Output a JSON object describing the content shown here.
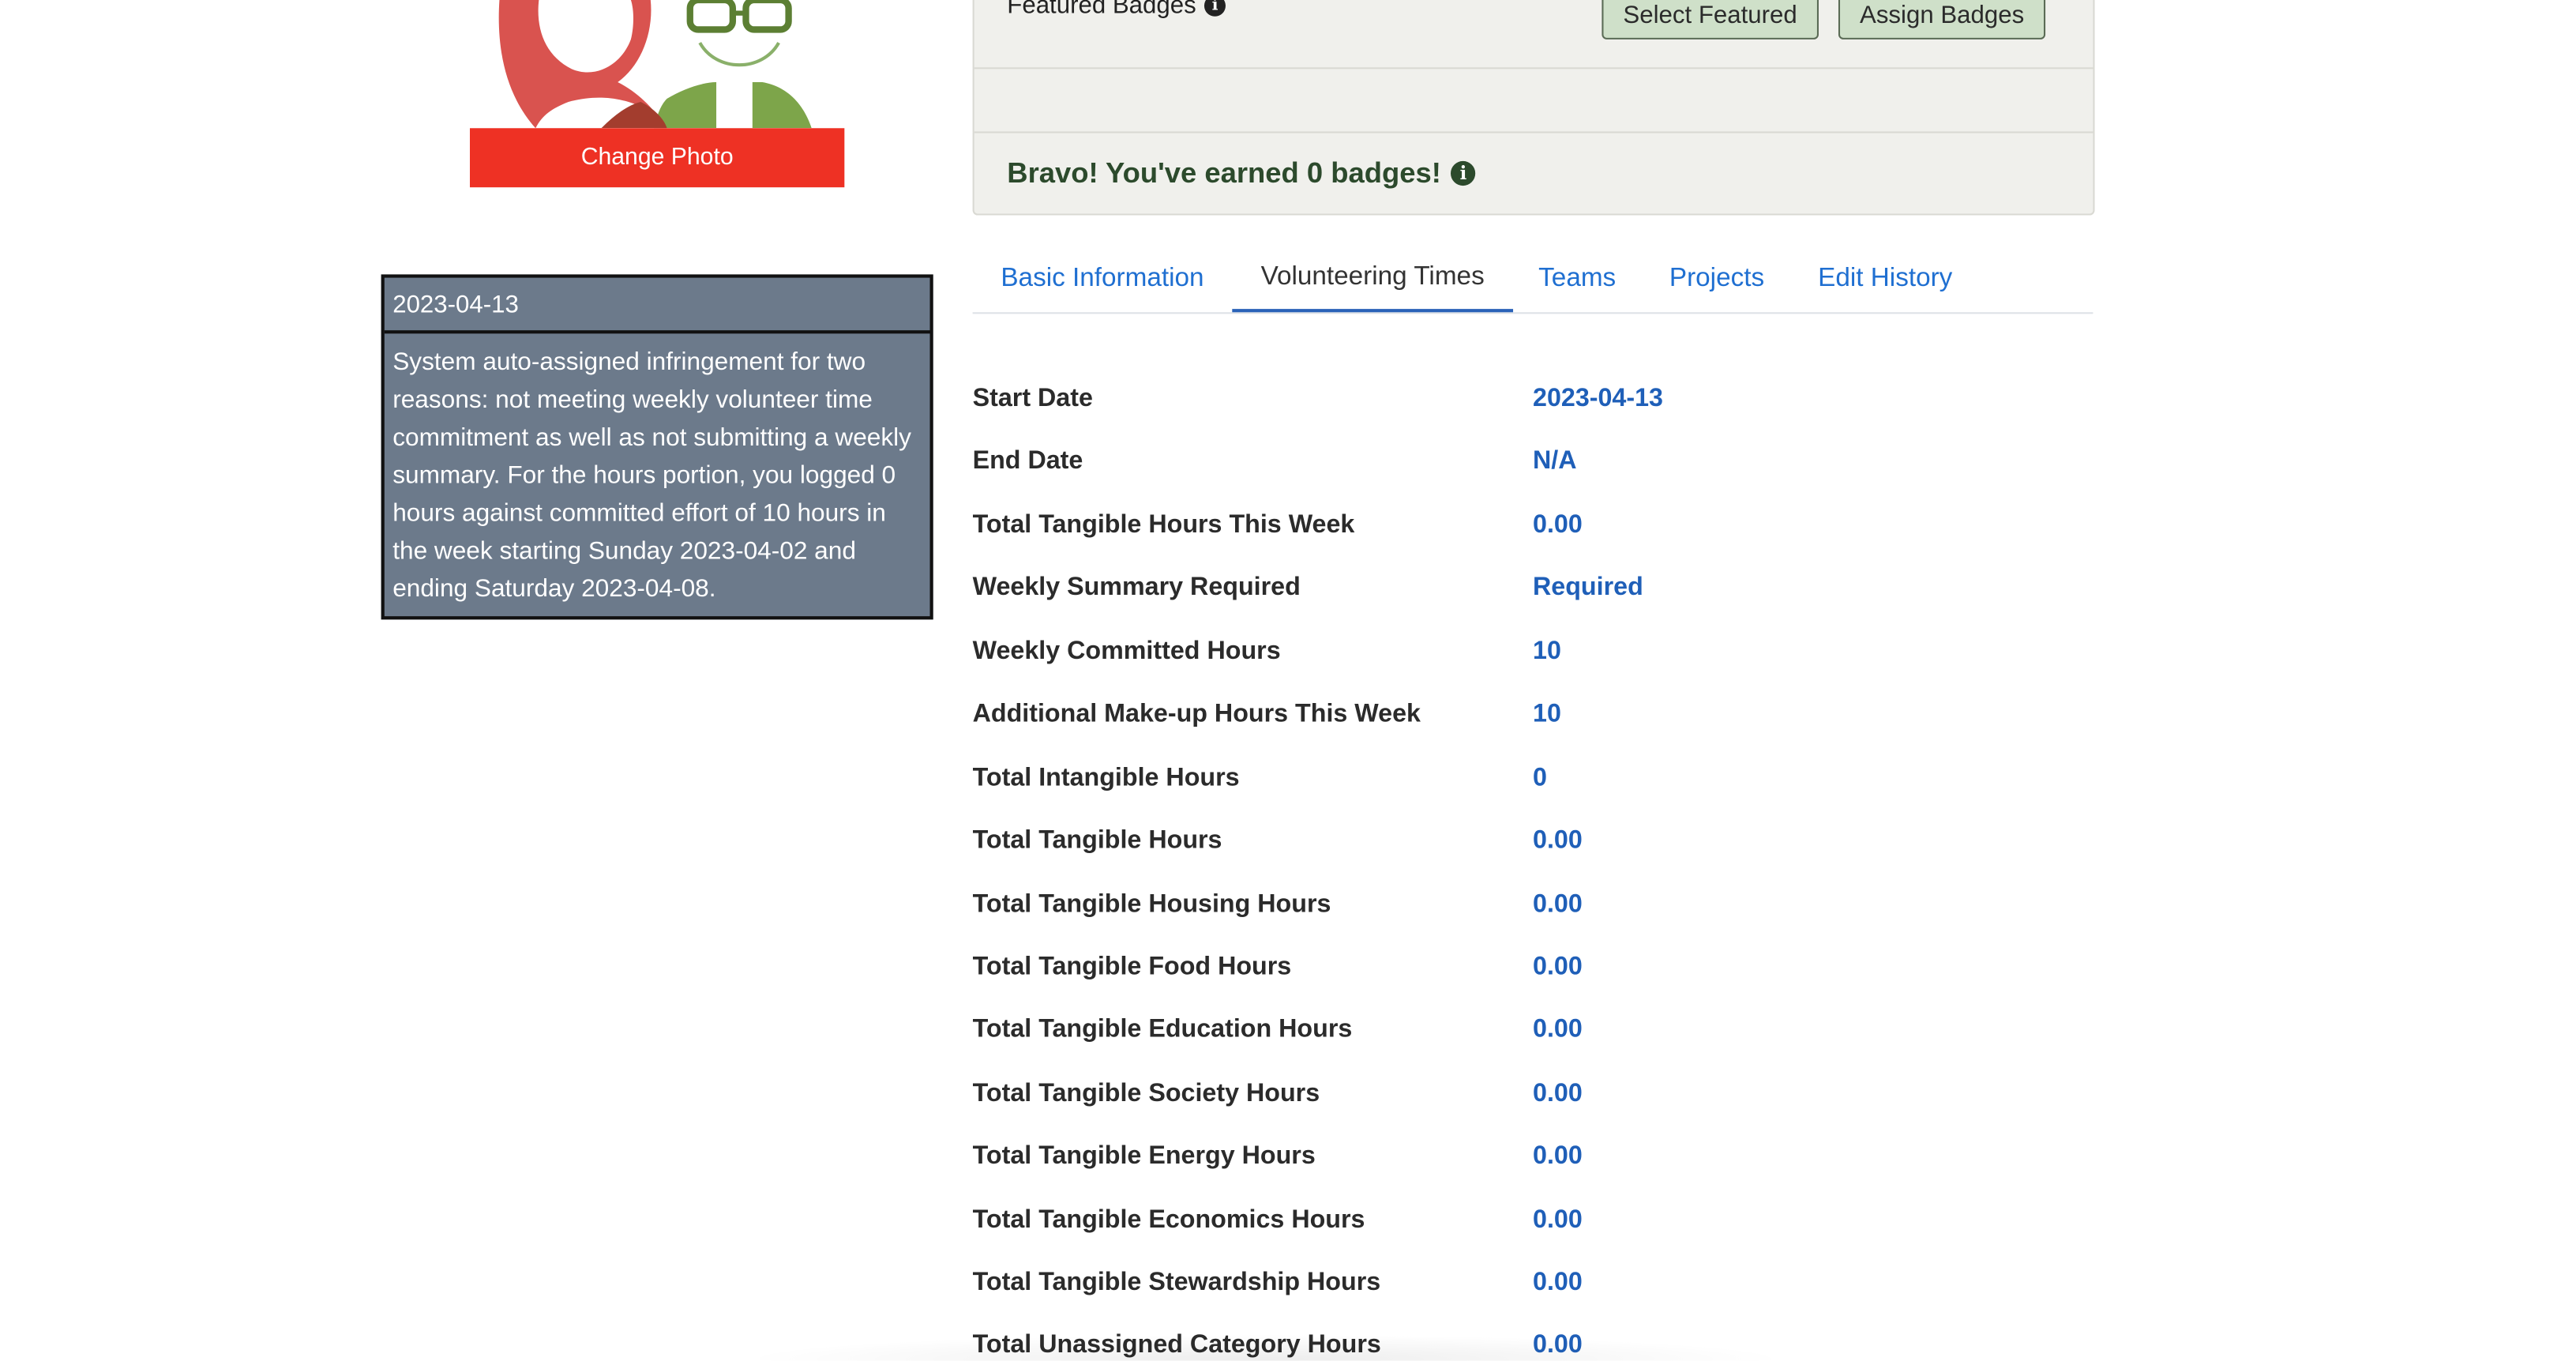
{
  "profile": {
    "change_photo_label": "Change Photo"
  },
  "infringement": {
    "date": "2023-04-13",
    "text": "System auto-assigned infringement for two reasons: not meeting weekly volunteer time commitment as well as not submitting a weekly summary. For the hours portion, you logged 0 hours against committed effort of 10 hours in the week starting Sunday 2023-04-02 and ending Saturday 2023-04-08."
  },
  "badges": {
    "header_title": "Featured Badges",
    "select_featured_label": "Select Featured",
    "assign_badges_label": "Assign Badges",
    "earned_text": "Bravo! You've earned 0 badges!",
    "icon": "info-circle-icon"
  },
  "tabs": [
    {
      "label": "Basic Information",
      "active": false
    },
    {
      "label": "Volunteering Times",
      "active": true
    },
    {
      "label": "Teams",
      "active": false
    },
    {
      "label": "Projects",
      "active": false
    },
    {
      "label": "Edit History",
      "active": false
    }
  ],
  "details": [
    {
      "label": "Start Date",
      "value": "2023-04-13"
    },
    {
      "label": "End Date",
      "value": "N/A"
    },
    {
      "label": "Total Tangible Hours This Week",
      "value": "0.00"
    },
    {
      "label": "Weekly Summary Required",
      "value": "Required"
    },
    {
      "label": "Weekly Committed Hours",
      "value": "10"
    },
    {
      "label": "Additional Make-up Hours This Week",
      "value": "10"
    },
    {
      "label": "Total Intangible Hours",
      "value": "0"
    },
    {
      "label": "Total Tangible Hours",
      "value": "0.00"
    },
    {
      "label": "Total Tangible Housing Hours",
      "value": "0.00"
    },
    {
      "label": "Total Tangible Food Hours",
      "value": "0.00"
    },
    {
      "label": "Total Tangible Education Hours",
      "value": "0.00"
    },
    {
      "label": "Total Tangible Society Hours",
      "value": "0.00"
    },
    {
      "label": "Total Tangible Energy Hours",
      "value": "0.00"
    },
    {
      "label": "Total Tangible Economics Hours",
      "value": "0.00"
    },
    {
      "label": "Total Tangible Stewardship Hours",
      "value": "0.00"
    },
    {
      "label": "Total Unassigned Category Hours",
      "value": "0.00"
    }
  ],
  "colors": {
    "accent_blue": "#1f6fd1",
    "change_photo_red": "#ee3124",
    "badge_green": "#2c4a2c",
    "infringement_bg": "#6c7a8b"
  }
}
